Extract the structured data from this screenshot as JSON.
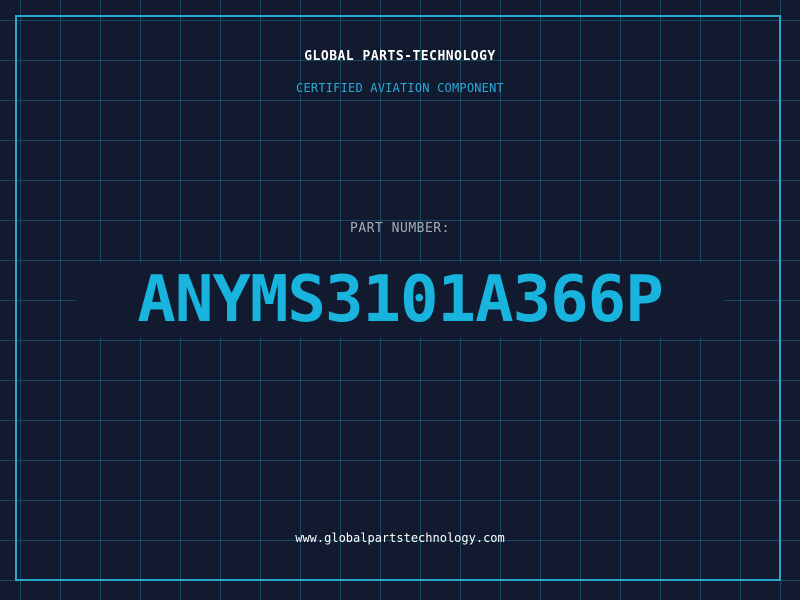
{
  "header": {
    "company": "GLOBAL PARTS-TECHNOLOGY",
    "subtitle": "CERTIFIED AVIATION COMPONENT"
  },
  "part": {
    "label": "PART NUMBER:",
    "number": "ANYMS3101A366P"
  },
  "footer": {
    "website": "www.globalpartstechnology.com"
  },
  "colors": {
    "background": "#111a2e",
    "grid": "#1c6e8c",
    "frame": "#27a7c9",
    "accent": "#18b4de",
    "label": "#a6adb8",
    "text": "#ffffff"
  }
}
